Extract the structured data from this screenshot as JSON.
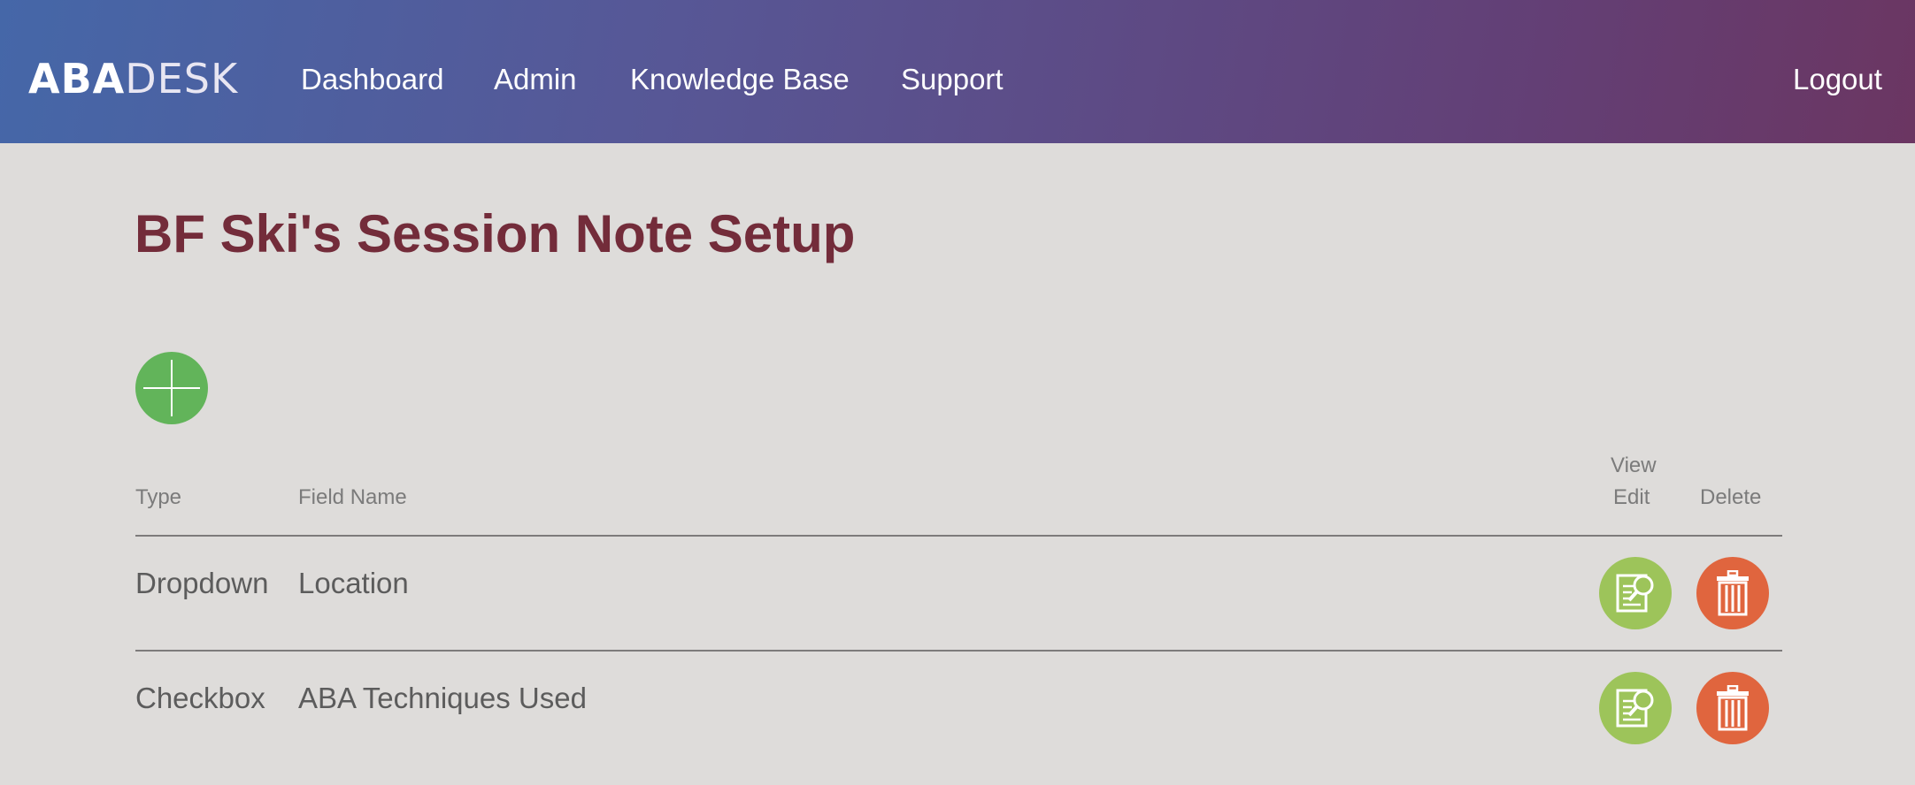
{
  "header": {
    "logo_bold": "ABA",
    "logo_light": "DESK",
    "nav": {
      "dashboard": "Dashboard",
      "admin": "Admin",
      "knowledge_base": "Knowledge Base",
      "support": "Support",
      "logout": "Logout"
    }
  },
  "page": {
    "title": "BF Ski's Session Note Setup"
  },
  "table": {
    "headers": {
      "type": "Type",
      "field_name": "Field Name",
      "view": "View",
      "edit": "Edit",
      "delete": "Delete"
    },
    "rows": [
      {
        "type": "Dropdown",
        "field_name": "Location"
      },
      {
        "type": "Checkbox",
        "field_name": "ABA Techniques Used"
      }
    ]
  },
  "icons": {
    "add": "plus-icon",
    "view_edit": "document-magnifier-icon",
    "delete": "trash-icon"
  },
  "colors": {
    "title": "#732c3a",
    "add_button": "#62b45a",
    "view_edit_button": "#9dc45a",
    "delete_button": "#e0653e",
    "header_gradient_start": "#4567a8",
    "header_gradient_end": "#6b3662"
  }
}
